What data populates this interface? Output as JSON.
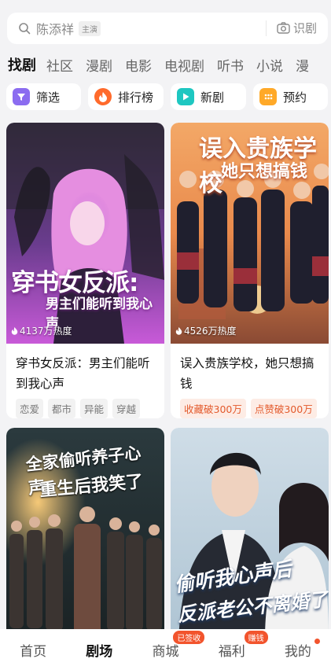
{
  "search": {
    "query": "陈添祥",
    "tag": "主演",
    "scan_label": "识剧",
    "icon": "search-icon",
    "scan_icon": "camera-icon"
  },
  "tabs": [
    {
      "label": "找剧",
      "active": true
    },
    {
      "label": "社区"
    },
    {
      "label": "漫剧"
    },
    {
      "label": "电影"
    },
    {
      "label": "电视剧"
    },
    {
      "label": "听书"
    },
    {
      "label": "小说"
    },
    {
      "label": "漫"
    }
  ],
  "quick_entries": [
    {
      "label": "筛选",
      "icon": "filter-icon",
      "color": "#8b6cf0"
    },
    {
      "label": "排行榜",
      "icon": "flame-icon",
      "color": "#ff6a2b"
    },
    {
      "label": "新剧",
      "icon": "play-icon",
      "color": "#1ec7c1"
    },
    {
      "label": "预约",
      "icon": "calendar-icon",
      "color": "#ffa928"
    }
  ],
  "cards": [
    {
      "title": "穿书女反派：男主们能听到我心声",
      "heat": "4137万热度",
      "tags": [
        "恋爱",
        "都市",
        "异能",
        "穿越"
      ],
      "poster_text_1": "穿书女反派:",
      "poster_text_2": "男主们能听到我心声"
    },
    {
      "title": "误入贵族学校，她只想搞钱",
      "heat": "4526万热度",
      "tags": [
        "收藏破300万",
        "点赞破300万"
      ],
      "poster_text_1": "误入贵族学校",
      "poster_text_2": "她只想搞钱"
    },
    {
      "title": "",
      "heat": "",
      "tags": [],
      "poster_text_1": "全家偷听养子心声,",
      "poster_text_2": "重生后我笑了"
    },
    {
      "title": "",
      "heat": "",
      "tags": [],
      "poster_text_1": "偷听我心声后",
      "poster_text_2": "反派老公不离婚了"
    }
  ],
  "bottom_nav": [
    {
      "label": "首页"
    },
    {
      "label": "剧场",
      "active": true
    },
    {
      "label": "商城",
      "badge": "已签收"
    },
    {
      "label": "福利",
      "badge": "赚钱"
    },
    {
      "label": "我的",
      "dot": true
    }
  ],
  "colors": {
    "accent": "#f2542d",
    "background": "#f3f3f5"
  }
}
